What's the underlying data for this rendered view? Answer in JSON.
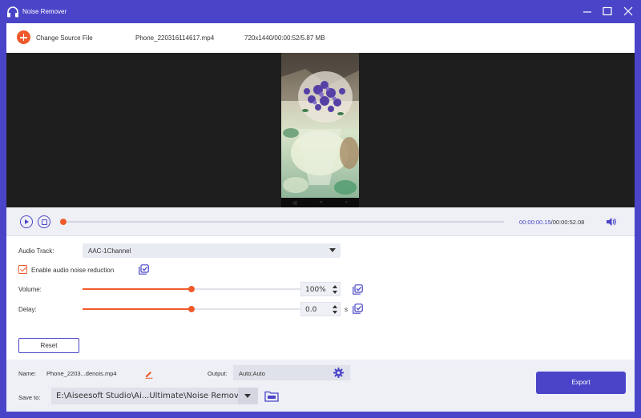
{
  "app": {
    "title": "Noise Remover",
    "accent": "#4a45c8",
    "highlight": "#f05a2b"
  },
  "window_controls": {
    "minimize_icon": "minimize-icon",
    "maximize_icon": "maximize-icon",
    "close_icon": "close-icon"
  },
  "source": {
    "change_label": "Change Source File",
    "file_name": "Phone_220316114617.mp4",
    "file_info": "720x1440/00:00:52/5.87 MB"
  },
  "player": {
    "current_time": "00:00:00.15",
    "separator": "/",
    "total_time": "00:00:52.08",
    "progress_fraction": 0.003,
    "phone_nav_buttons": [
      "◁",
      "○",
      "▫"
    ]
  },
  "audio": {
    "track_label": "Audio Track:",
    "track_value": "AAC-1Channel",
    "noise_reduction_label": "Enable audio noise reduction",
    "noise_reduction_checked": true,
    "volume_label": "Volume:",
    "volume_value": "100%",
    "volume_fraction": 0.5,
    "delay_label": "Delay:",
    "delay_value": "0.0",
    "delay_unit": "s",
    "delay_fraction": 0.5,
    "reset_label": "Reset"
  },
  "output": {
    "name_label": "Name:",
    "name_value": "Phone_2203...denois.mp4",
    "output_label": "Output:",
    "output_value": "Auto;Auto",
    "save_to_label": "Save to:",
    "save_to_value": "E:\\Aiseesoft Studio\\Ai...Ultimate\\Noise Remover",
    "export_label": "Export"
  }
}
